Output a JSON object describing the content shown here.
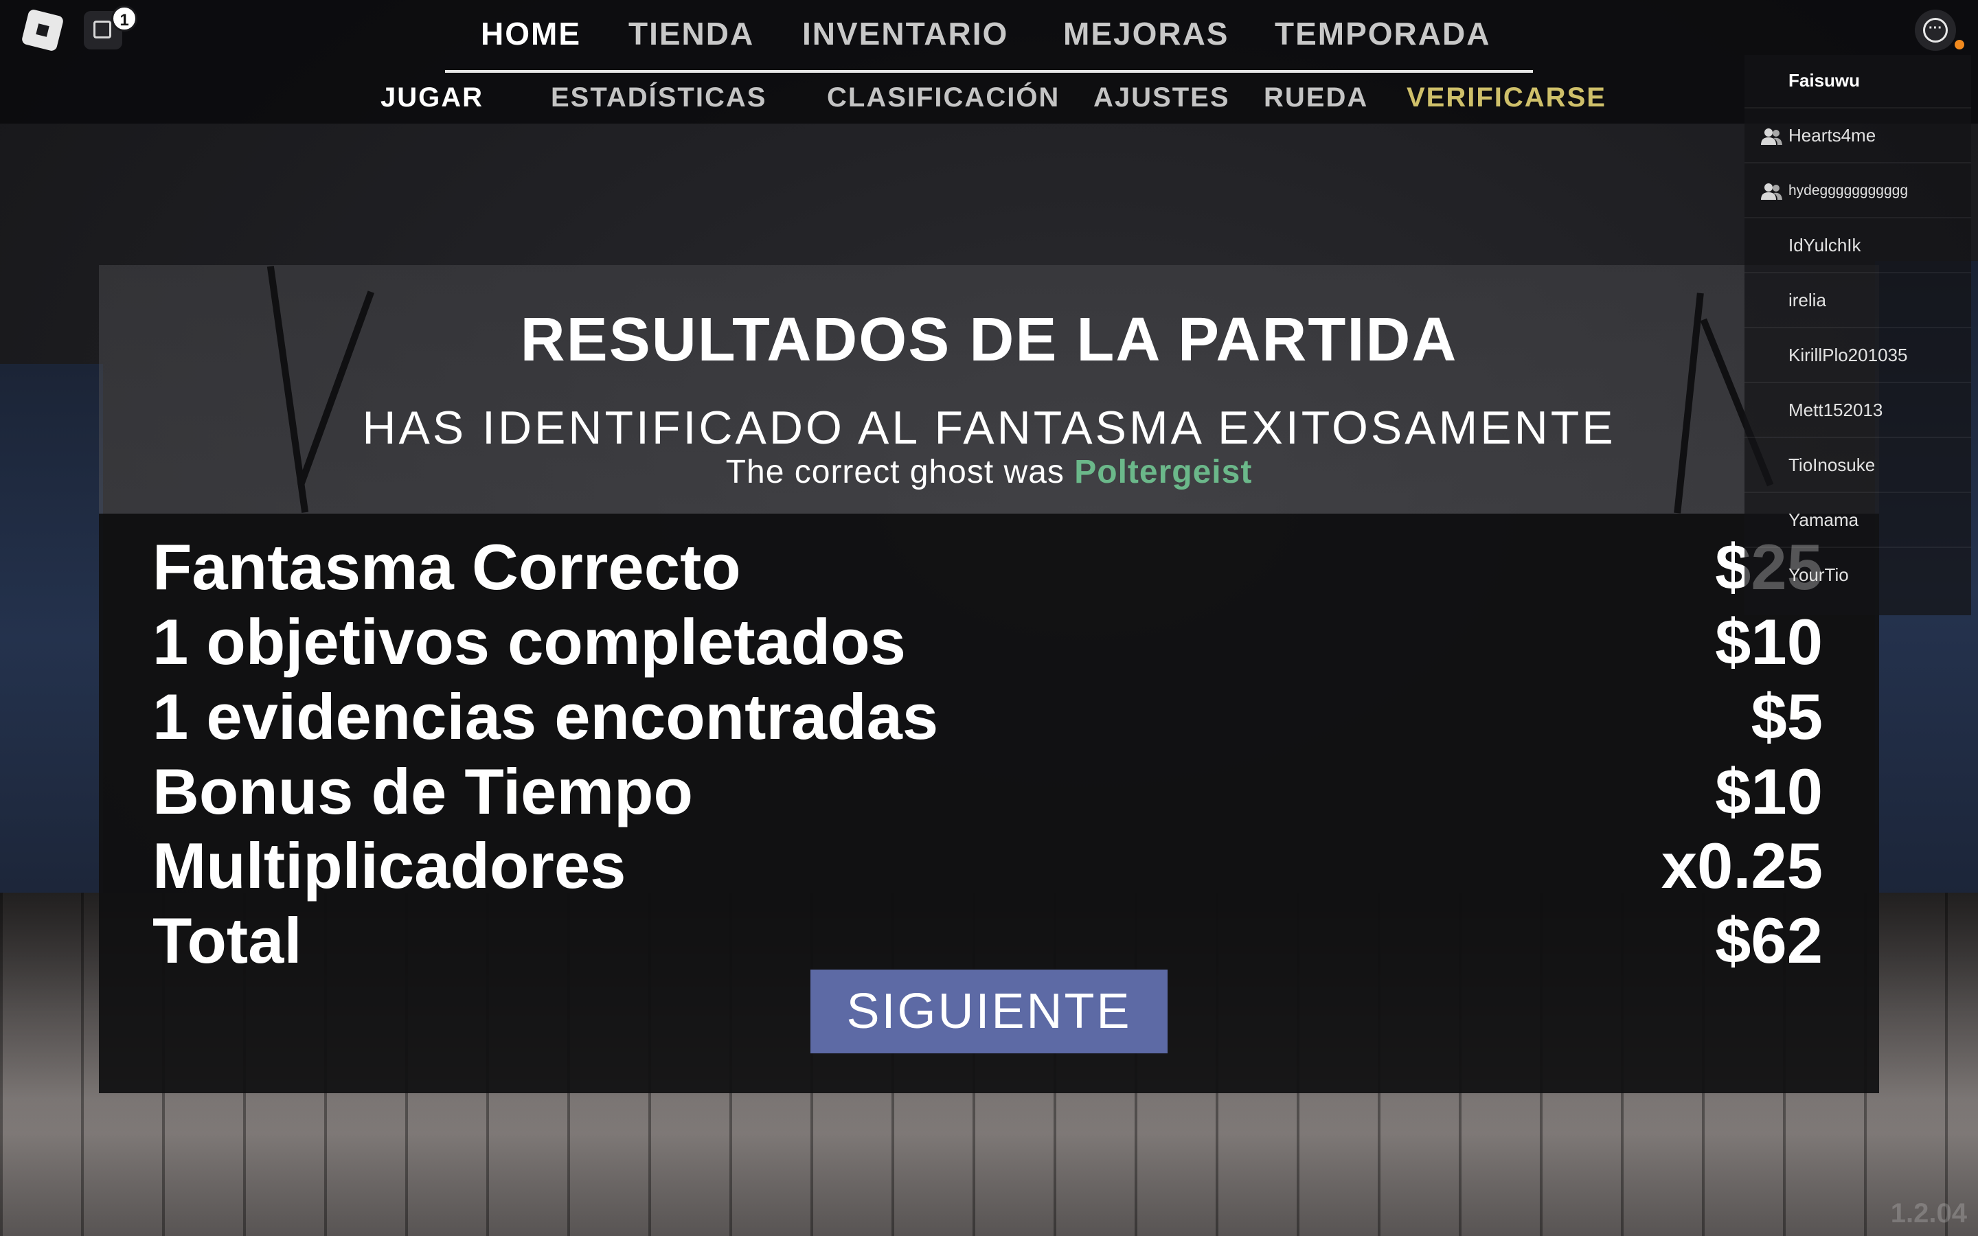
{
  "topbar": {
    "chat_badge": "1",
    "nav_main": [
      "HOME",
      "TIENDA",
      "INVENTARIO",
      "MEJORAS",
      "TEMPORADA"
    ],
    "nav_sub": [
      "JUGAR",
      "ESTADÍSTICAS",
      "CLASIFICACIÓN",
      "AJUSTES",
      "RUEDA",
      "VERIFICARSE"
    ],
    "menu_icon": "ellipsis-icon"
  },
  "playerlist": {
    "players": [
      {
        "name": "Faisuwu",
        "self": true,
        "friend": false
      },
      {
        "name": "Hearts4me",
        "self": false,
        "friend": true
      },
      {
        "name": "hydeggggggggggg",
        "self": false,
        "friend": true
      },
      {
        "name": "IdYulchIk",
        "self": false,
        "friend": false
      },
      {
        "name": "irelia",
        "self": false,
        "friend": false
      },
      {
        "name": "KirillPlo201035",
        "self": false,
        "friend": false
      },
      {
        "name": "Mett152013",
        "self": false,
        "friend": false
      },
      {
        "name": "TioInosuke",
        "self": false,
        "friend": false
      },
      {
        "name": "Yamama",
        "self": false,
        "friend": false
      },
      {
        "name": "YourTio",
        "self": false,
        "friend": false
      }
    ]
  },
  "results": {
    "title": "RESULTADOS DE LA PARTIDA",
    "subtitle": "HAS IDENTIFICADO AL FANTASMA EXITOSAMENTE",
    "ghost_prefix": "The correct ghost was ",
    "ghost_name": "Poltergeist",
    "ghost_color": "#6bb88a",
    "rows": [
      {
        "label": "Fantasma Correcto",
        "value": "$25"
      },
      {
        "label": "1 objetivos completados",
        "value": "$10"
      },
      {
        "label": "1 evidencias encontradas",
        "value": "$5"
      },
      {
        "label": "Bonus de Tiempo",
        "value": "$10"
      },
      {
        "label": "Multiplicadores",
        "value": "x0.25"
      },
      {
        "label": "Total",
        "value": "$62"
      }
    ],
    "next_label": "SIGUIENTE",
    "button_color": "#5d6aa5"
  },
  "version": "1.2.04"
}
